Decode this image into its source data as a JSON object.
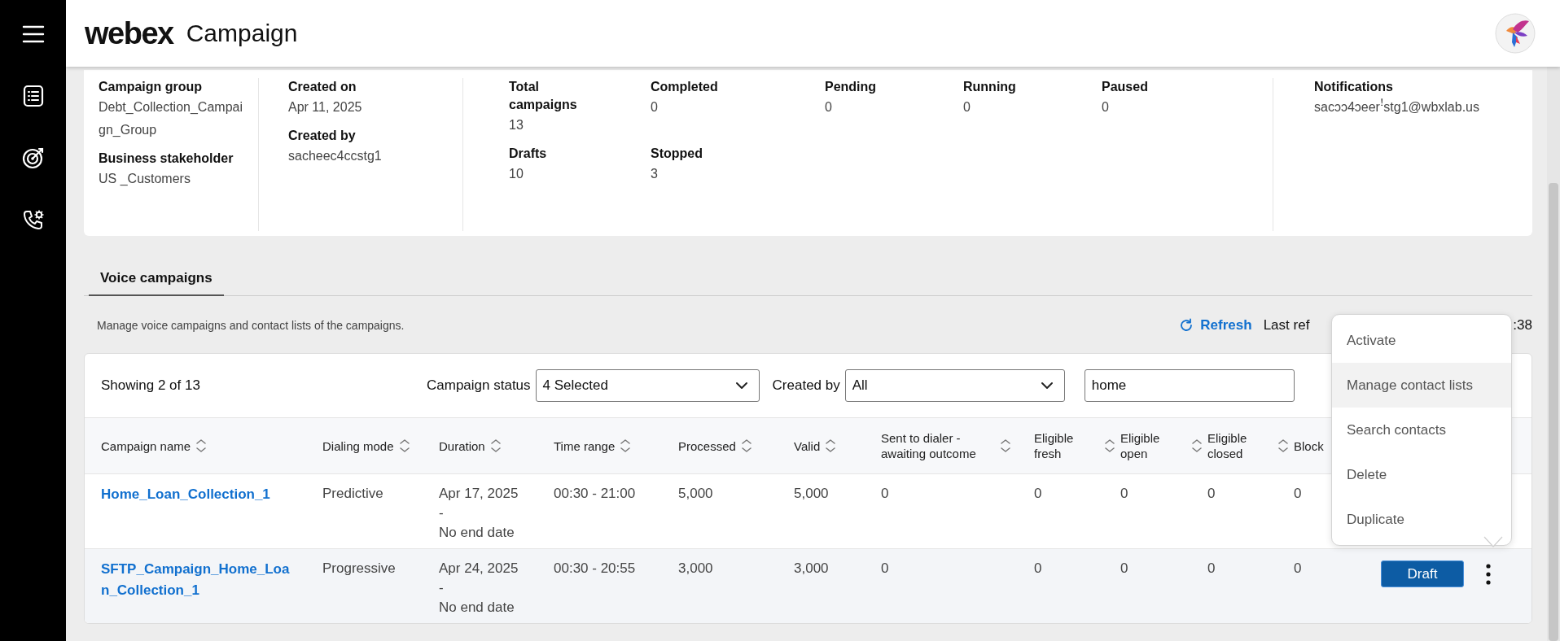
{
  "sidebar": {
    "items": [
      {
        "kind": "menu"
      },
      {
        "kind": "list"
      },
      {
        "kind": "target"
      },
      {
        "kind": "phone"
      }
    ]
  },
  "header": {
    "logo": "webex",
    "title": "Campaign"
  },
  "summary": {
    "sections": [
      {
        "kind": "fields",
        "fields": [
          {
            "label": "Campaign group",
            "value": "Debt_Collection_Campaign_Group"
          },
          {
            "label": "Business stakeholder",
            "value": "US _Customers"
          }
        ]
      },
      {
        "kind": "fields",
        "fields": [
          {
            "label": "Created on",
            "value": "Apr 11, 2025"
          },
          {
            "label": "Created by",
            "value": "sacheec4ccstg1"
          }
        ]
      },
      {
        "kind": "stats",
        "fields": [
          {
            "label": "Total campaigns",
            "value": "13"
          },
          {
            "label": "Completed",
            "value": "0"
          },
          {
            "label": "Pending",
            "value": "0"
          },
          {
            "label": "Running",
            "value": "0"
          },
          {
            "label": "Paused",
            "value": "0"
          },
          {
            "label": "Drafts",
            "value": "10"
          },
          {
            "label": "Stopped",
            "value": "3"
          }
        ]
      },
      {
        "kind": "fields",
        "fields": [
          {
            "label": "Notifications",
            "value": "sacɔɔ4ɔeerꜝstg1@wbxlab.us"
          }
        ]
      }
    ]
  },
  "tabs": [
    {
      "label": "Voice campaigns",
      "selected": true
    }
  ],
  "description": "Manage voice campaigns and contact lists of the campaigns.",
  "refresh": {
    "label": "Refresh",
    "last_refreshed_start": "Last ref",
    "last_refreshed_end": ":38"
  },
  "table": {
    "showing": "Showing 2 of 13",
    "filters": [
      {
        "label": "Campaign status",
        "value": "4 Selected"
      },
      {
        "label": "Created by",
        "value": "All"
      }
    ],
    "search": {
      "value": "home"
    },
    "columns": [
      {
        "label": "Campaign name"
      },
      {
        "label": "Dialing mode"
      },
      {
        "label": "Duration"
      },
      {
        "label": "Time range"
      },
      {
        "label": "Processed"
      },
      {
        "label": "Valid"
      },
      {
        "label": "Sent to dialer - awaiting outcome"
      },
      {
        "label": "Eligible fresh"
      },
      {
        "label": "Eligible open"
      },
      {
        "label": "Eligible closed"
      },
      {
        "label": "Block"
      }
    ],
    "rows": [
      {
        "selected": false,
        "cells": [
          "Home_Loan_Collection_1",
          "Predictive",
          "Apr 17, 2025\n-\nNo end date",
          "00:30 - 21:00",
          "5,000",
          "5,000",
          "0",
          "0",
          "0",
          "0",
          "0"
        ]
      },
      {
        "selected": true,
        "cells": [
          "SFTP_Campaign_Home_Loan_Collection_1",
          "Progressive",
          "Apr 24, 2025\n-\nNo end date",
          "00:30 - 20:55",
          "3,000",
          "3,000",
          "0",
          "0",
          "0",
          "0",
          "0"
        ],
        "status": "Draft"
      }
    ]
  },
  "menu": {
    "items": [
      {
        "label": "Activate",
        "highlighted": false
      },
      {
        "label": "Manage contact lists",
        "highlighted": true
      },
      {
        "label": "Search contacts",
        "highlighted": false
      },
      {
        "label": "Delete",
        "highlighted": false
      },
      {
        "label": "Duplicate",
        "highlighted": false
      }
    ]
  }
}
